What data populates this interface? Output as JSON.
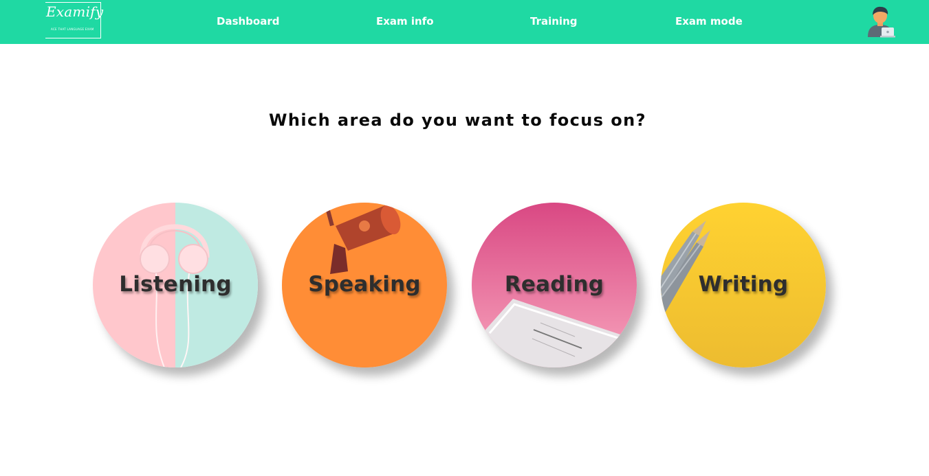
{
  "brand": {
    "name": "Examify",
    "tagline": "ACE THAT LANGUAGE EXAM"
  },
  "nav": {
    "dashboard": "Dashboard",
    "exam_info": "Exam info",
    "training": "Training",
    "exam_mode": "Exam mode"
  },
  "user": {
    "avatar_icon": "user-avatar-icon"
  },
  "page": {
    "heading": "Which area do you want to focus on?"
  },
  "areas": [
    {
      "label": "Listening",
      "icon": "headphones-icon",
      "color": "#ffc7cc"
    },
    {
      "label": "Speaking",
      "icon": "megaphone-icon",
      "color": "#ff8a30"
    },
    {
      "label": "Reading",
      "icon": "book-icon",
      "color": "#f0719c"
    },
    {
      "label": "Writing",
      "icon": "pencil-icon",
      "color": "#fecb30"
    }
  ],
  "colors": {
    "accent": "#1fd9a3",
    "text": "#0a0a0a"
  }
}
